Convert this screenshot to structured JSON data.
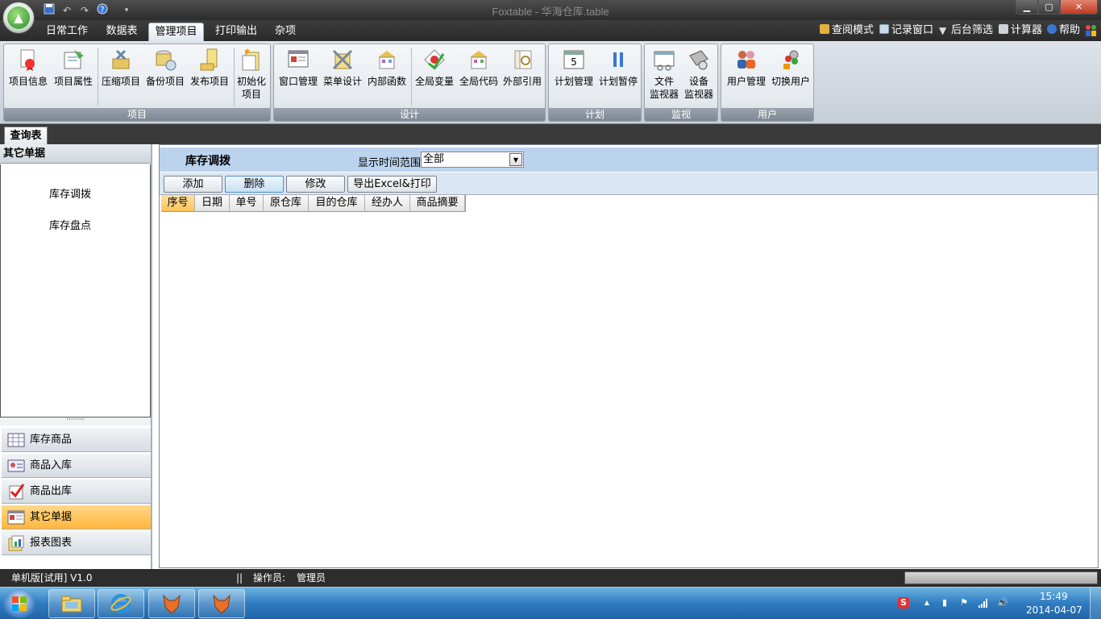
{
  "window": {
    "title": "Foxtable - 华海仓库.table"
  },
  "menu_tabs": [
    {
      "label": "日常工作"
    },
    {
      "label": "数据表"
    },
    {
      "label": "管理项目",
      "active": true
    },
    {
      "label": "打印输出"
    },
    {
      "label": "杂项"
    }
  ],
  "right_menu": [
    {
      "label": "查阅模式",
      "icon": "lock-icon"
    },
    {
      "label": "记录窗口",
      "icon": "window-icon"
    },
    {
      "label": "后台筛选",
      "icon": "filter-icon"
    },
    {
      "label": "计算器",
      "icon": "calculator-icon"
    },
    {
      "label": "帮助",
      "icon": "help-icon"
    }
  ],
  "ribbon": {
    "groups": [
      {
        "label": "项目",
        "buttons": [
          {
            "label": "项目信息",
            "icon": "project-info-icon"
          },
          {
            "label": "项目属性",
            "icon": "project-properties-icon"
          },
          {
            "label": "压缩项目",
            "icon": "compress-icon"
          },
          {
            "label": "备份项目",
            "icon": "backup-icon"
          },
          {
            "label": "发布项目",
            "icon": "publish-icon"
          },
          {
            "label1": "初始化",
            "label2": "项目",
            "icon": "initialize-icon"
          }
        ]
      },
      {
        "label": "设计",
        "buttons": [
          {
            "label": "窗口管理",
            "icon": "window-manage-icon"
          },
          {
            "label": "菜单设计",
            "icon": "menu-design-icon"
          },
          {
            "label": "内部函数",
            "icon": "function-icon"
          },
          {
            "label": "全局变量",
            "icon": "global-variable-icon"
          },
          {
            "label": "全局代码",
            "icon": "global-code-icon"
          },
          {
            "label": "外部引用",
            "icon": "external-reference-icon"
          }
        ]
      },
      {
        "label": "计划",
        "buttons": [
          {
            "label": "计划管理",
            "icon": "calendar-icon"
          },
          {
            "label": "计划暂停",
            "icon": "pause-icon"
          }
        ]
      },
      {
        "label": "监视",
        "buttons": [
          {
            "label1": "文件",
            "label2": "监视器",
            "icon": "file-monitor-icon"
          },
          {
            "label1": "设备",
            "label2": "监视器",
            "icon": "device-monitor-icon"
          }
        ]
      },
      {
        "label": "用户",
        "buttons": [
          {
            "label": "用户管理",
            "icon": "users-icon"
          },
          {
            "label": "切换用户",
            "icon": "switch-user-icon"
          }
        ]
      }
    ]
  },
  "doc_tab": {
    "label": "查询表"
  },
  "sidebar": {
    "title": "其它单据",
    "links": [
      "库存调拨",
      "库存盘点"
    ],
    "splitter": "········",
    "nav": [
      {
        "label": "库存商品",
        "icon": "table-grid-icon"
      },
      {
        "label": "商品入库",
        "icon": "contact-card-icon"
      },
      {
        "label": "商品出库",
        "icon": "checklist-icon"
      },
      {
        "label": "其它单据",
        "icon": "form-icon",
        "active": true
      },
      {
        "label": "报表图表",
        "icon": "report-icon"
      }
    ]
  },
  "main": {
    "heading": "库存调拨",
    "range_label": "显示时间范围",
    "range_value": "全部",
    "buttons": {
      "add": "添加",
      "delete": "删除",
      "edit": "修改",
      "export": "导出Excel&打印"
    },
    "columns": [
      "序号",
      "日期",
      "单号",
      "原仓库",
      "目的仓库",
      "经办人",
      "商品摘要"
    ]
  },
  "statusbar": {
    "edition": "单机版[试用] V1.0",
    "separator": "||",
    "operator_label": "操作员:",
    "operator_value": "管理员"
  },
  "taskbar": {
    "time": "15:49",
    "date": "2014-04-07"
  },
  "colors": {
    "accent_orange": "#ffc35a",
    "filter_bar_blue": "#bcd3ee",
    "ribbon_group_label": "#8a939d"
  }
}
